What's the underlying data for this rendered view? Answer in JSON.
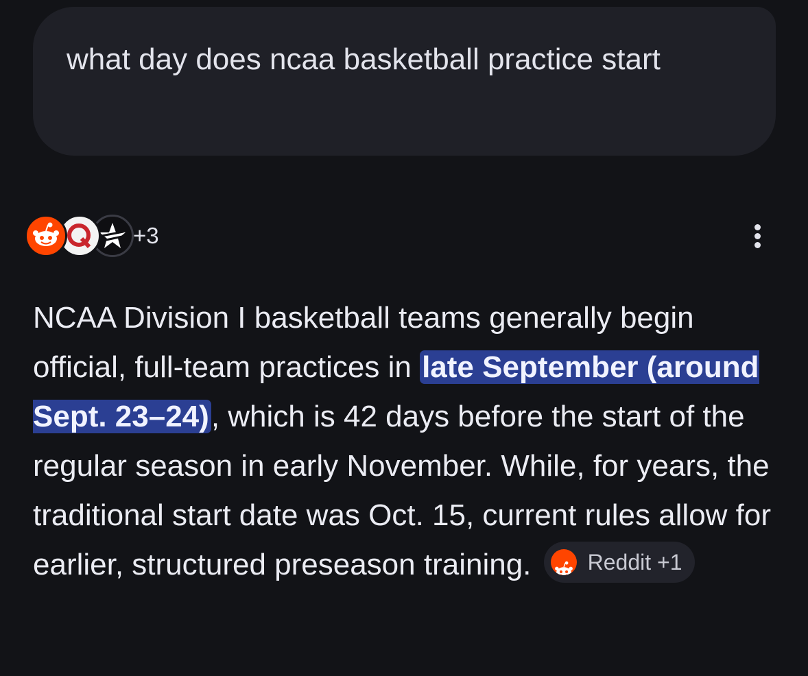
{
  "query": {
    "text": "what day does ncaa basketball practice start"
  },
  "sources": {
    "icons": [
      "reddit-icon",
      "quora-icon",
      "star-logo-icon"
    ],
    "more_count": "+3"
  },
  "answer": {
    "text_before": "NCAA Division I basketball teams generally begin official, full-team practices in ",
    "highlight": "late September (around Sept. 23–24)",
    "text_after": ", which is 42 days before the start of the regular season in early November. While, for years, the traditional start date was Oct. 15, current rules allow for earlier, structured preseason training.",
    "citation_chip": {
      "icon": "reddit-icon",
      "label": "Reddit +1"
    }
  },
  "colors": {
    "background": "#121317",
    "query_bubble": "#1f2027",
    "highlight": "#2b3f93",
    "reddit": "#ff4500"
  }
}
